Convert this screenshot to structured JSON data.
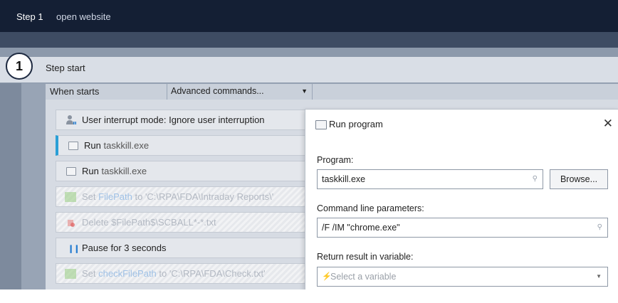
{
  "header": {
    "step_number": "Step 1",
    "step_title": "open website"
  },
  "step": {
    "circle_number": "1",
    "label": "Step start"
  },
  "toolbar": {
    "when_starts": "When starts",
    "advanced_commands": "Advanced commands..."
  },
  "commands": [
    {
      "name": "User interrupt mode:",
      "arg": "Ignore user interruption",
      "state": "normal",
      "icon": "user-icon"
    },
    {
      "name": "Run",
      "arg": "taskkill.exe",
      "state": "selected",
      "icon": "window-icon"
    },
    {
      "name": "Run",
      "arg": "taskkill.exe",
      "state": "normal",
      "icon": "window-icon"
    },
    {
      "name": "Set",
      "var": "FilePath",
      "to": "to",
      "arg": "'C:\\RPA\\FDA\\Intraday Reports\\'",
      "state": "disabled",
      "icon": "set-icon"
    },
    {
      "name": "Delete",
      "arg": "$FilePath$\\SCBALL*-*.txt",
      "state": "disabled",
      "icon": "delete-icon"
    },
    {
      "name": "Pause for 3 seconds",
      "arg": "",
      "state": "normal",
      "icon": "pause-icon"
    },
    {
      "name": "Set",
      "var": "checkFilePath",
      "to": "to",
      "arg": "'C:\\RPA\\FDA\\Check.txt'",
      "state": "disabled",
      "icon": "set-icon"
    }
  ],
  "dialog": {
    "title": "Run program",
    "program_label": "Program:",
    "program_value": "taskkill.exe",
    "browse_label": "Browse...",
    "params_label": "Command line parameters:",
    "params_value": "/F /IM \"chrome.exe\"",
    "result_label": "Return result in variable:",
    "result_placeholder": "Select a variable"
  },
  "colors": {
    "header_bg": "#141f34",
    "accent": "#2a9fd6",
    "variable": "#2a7fd1"
  }
}
